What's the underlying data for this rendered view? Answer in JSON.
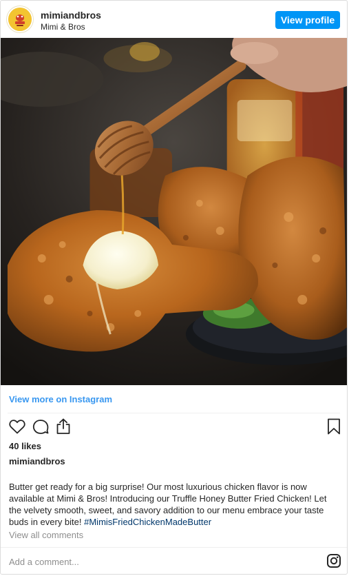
{
  "header": {
    "username": "mimiandbros",
    "display_name": "Mimi & Bros",
    "view_profile_label": "View profile",
    "avatar_icon": "mimi-and-bros-logo"
  },
  "photo": {
    "subject": "fried-chicken-with-honey-dipper-and-butter"
  },
  "view_more_label": "View more on Instagram",
  "actions": {
    "icons": [
      "heart-icon",
      "comment-icon",
      "share-icon",
      "bookmark-icon"
    ]
  },
  "likes": "40 likes",
  "caption": {
    "username": "mimiandbros",
    "text": "Butter get ready for a big surprise! Our most luxurious chicken flavor is now available at Mimi & Bros! Introducing our Truffle Honey Butter Fried Chicken! Let the velvety smooth, sweet, and savory addition to our menu embrace your taste buds in every bite! ",
    "hashtag": "#MimisFriedChickenMadeButter"
  },
  "view_comments_label": "View all comments",
  "comment_placeholder": "Add a comment...",
  "colors": {
    "accent": "#0095f6",
    "link": "#3897f0",
    "muted": "#8e8e8e",
    "hashtag": "#00376b"
  }
}
